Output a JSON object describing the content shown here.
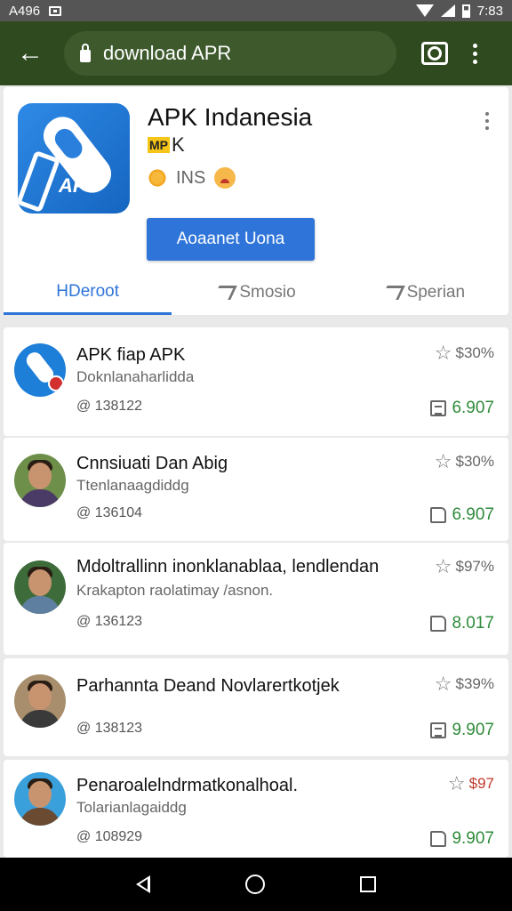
{
  "status_bar": {
    "time_left": "A496",
    "time_right": "7:83"
  },
  "browser": {
    "url": "download APR"
  },
  "app": {
    "title": "APK Indanesia",
    "badge": "MP",
    "subtitle_suffix": "K",
    "meta_text": "INS",
    "icon_label": "AP",
    "install_label": "Aoaanet Uona",
    "tabs": [
      {
        "label": "HDeroot",
        "active": true
      },
      {
        "label": "Smosio",
        "active": false
      },
      {
        "label": "Sperian",
        "active": false
      }
    ]
  },
  "items": [
    {
      "title": "APK fiap APK",
      "subtitle": "Doknlanaharlidda",
      "count": "@ 138122",
      "rating": "$30%",
      "rating_color": "#666666",
      "downloads": "6.907",
      "download_icon": "doc-icon",
      "avatar": "app"
    },
    {
      "title": "Cnnsiuati Dan Abig",
      "subtitle": "Ttenlanaagdiddg",
      "count": "@ 136104",
      "rating": "$30%",
      "rating_color": "#666666",
      "downloads": "6.907",
      "download_icon": "thumb-icon",
      "avatar": "person"
    },
    {
      "title": "Mdoltrallinn inonklanablaa, lendlendan",
      "subtitle": "Krakapton raolatimay /asnon.",
      "count": "@ 136123",
      "rating": "$97%",
      "rating_color": "#666666",
      "downloads": "8.017",
      "download_icon": "thumb-icon",
      "avatar": "person"
    },
    {
      "title": "Parhannta Deand Novlarertkotjek",
      "subtitle": "",
      "count": "@ 138123",
      "rating": "$39%",
      "rating_color": "#666666",
      "downloads": "9.907",
      "download_icon": "doc-icon",
      "avatar": "person"
    },
    {
      "title": "Penaroalelndrmatkonalhoal.",
      "subtitle": "Tolarianlagaiddg",
      "count": "@ 108929",
      "rating": "$97",
      "rating_color": "#c0392b",
      "downloads": "9.907",
      "download_icon": "thumb-icon",
      "avatar": "person"
    }
  ]
}
